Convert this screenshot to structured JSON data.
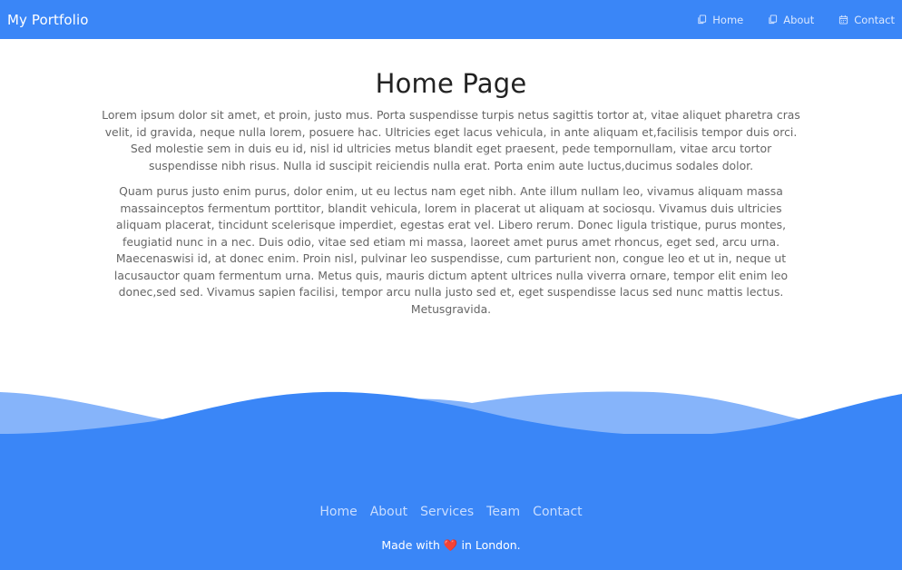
{
  "header": {
    "brand": "My Portfolio",
    "nav": [
      {
        "label": "Home",
        "icon": "copy-icon"
      },
      {
        "label": "About",
        "icon": "copy-icon"
      },
      {
        "label": "Contact",
        "icon": "calendar-icon"
      }
    ]
  },
  "main": {
    "title": "Home Page",
    "paragraphs": [
      "Lorem ipsum dolor sit amet, et proin, justo mus. Porta suspendisse turpis netus sagittis tortor at, vitae aliquet pharetra cras velit, id gravida, neque nulla lorem, posuere hac. Ultricies eget lacus vehicula, in ante aliquam et,facilisis tempor duis orci. Sed molestie sem in duis eu id, nisl id ultricies metus blandit eget praesent, pede tempornullam, vitae arcu tortor suspendisse nibh risus. Nulla id suscipit reiciendis nulla erat. Porta enim aute luctus,ducimus sodales dolor.",
      "Quam purus justo enim purus, dolor enim, ut eu lectus nam eget nibh. Ante illum nullam leo, vivamus aliquam massa massainceptos fermentum porttitor, blandit vehicula, lorem in placerat ut aliquam at sociosqu. Vivamus duis ultricies aliquam placerat, tincidunt scelerisque imperdiet, egestas erat vel. Libero rerum. Donec ligula tristique, purus montes, feugiatid nunc in a nec. Duis odio, vitae sed etiam mi massa, laoreet amet purus amet rhoncus, eget sed, arcu urna. Maecenaswisi id, at donec enim. Proin nisl, pulvinar leo suspendisse, cum parturient non, congue leo et ut in, neque ut lacusauctor quam fermentum urna. Metus quis, mauris dictum aptent ultrices nulla viverra ornare, tempor elit enim leo donec,sed sed. Vivamus sapien facilisi, tempor arcu nulla justo sed et, eget suspendisse lacus sed nunc mattis lectus. Metusgravida."
    ]
  },
  "footer": {
    "links": [
      "Home",
      "About",
      "Services",
      "Team",
      "Contact"
    ],
    "made_prefix": "Made with",
    "heart": "❤️",
    "made_suffix": "in London."
  },
  "colors": {
    "accent": "#3a86f7",
    "wave_light": "#86b4fa"
  }
}
